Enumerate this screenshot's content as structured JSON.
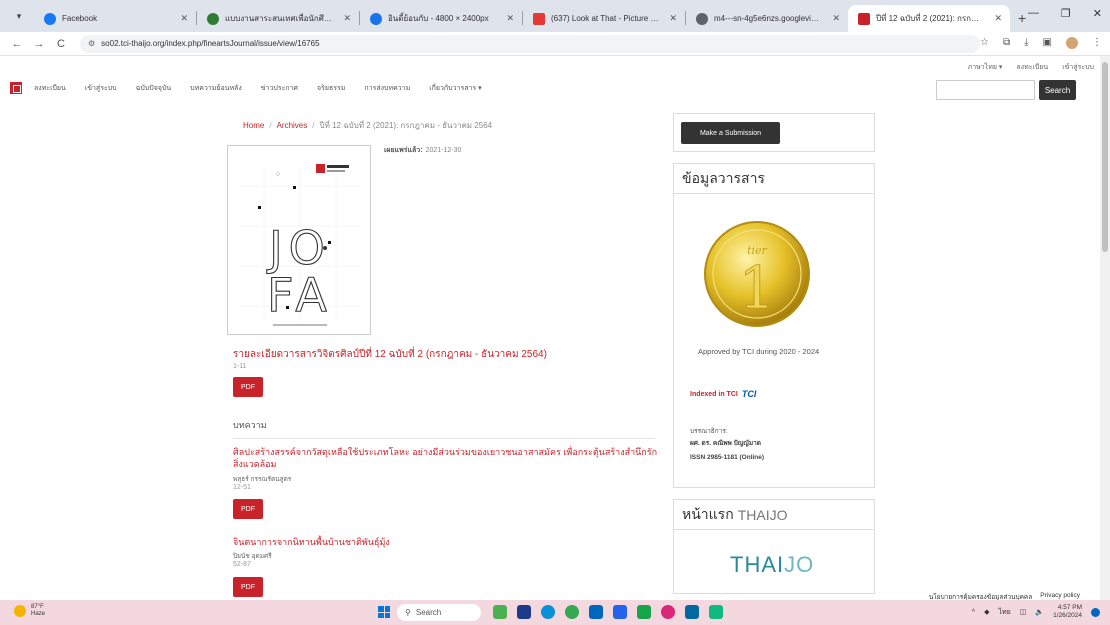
{
  "browser": {
    "tabs": [
      {
        "title": "Facebook",
        "color": "#1877f2",
        "active": false
      },
      {
        "title": "แบบงานสาระสนเทศเพื่อนักศึกษ",
        "color": "#2e7d32",
        "active": false
      },
      {
        "title": "อินดี้ย้อนกับ - 4800 × 2400px",
        "color": "#1a73e8",
        "active": false
      },
      {
        "title": "(637) Look at That - Picture Boo",
        "color": "#e53935",
        "active": false
      },
      {
        "title": "m4---sn-4g5e6nzs.googlevideo",
        "color": "#5f6368",
        "active": false
      },
      {
        "title": "ปีที่ 12 ฉบับที่ 2 (2021): กรกฎาคม",
        "color": "#c8232a",
        "active": true
      }
    ],
    "url": "so02.tci-thaijo.org/index.php/fineartsJournal/issue/view/16765"
  },
  "site": {
    "topright_links": [
      "ภาษาไทย ▾",
      "ลงทะเบียน",
      "เข้าสู่ระบบ"
    ],
    "nav_items": [
      "ลงทะเบียน",
      "เข้าสู่ระบบ",
      "ฉบับปัจจุบัน",
      "บทความย้อนหลัง",
      "ข่าวประกาศ",
      "จริยธรรม",
      "การส่งบทความ",
      "เกี่ยวกับวารสาร ▾"
    ],
    "search_button": "Search"
  },
  "breadcrumb": {
    "home": "Home",
    "archives": "Archives",
    "current": "ปีที่ 12 ฉบับที่ 2 (2021): กรกฎาคม - ธันวาคม 2564"
  },
  "issue": {
    "published_label": "เผยแพร่แล้ว:",
    "published_date": "2021-12-30",
    "cover_text": "JOFA",
    "toc_title": "รายละเอียดวารสารวิจิตรศิลป์ปีที่ 12 ฉบับที่ 2 (กรกฎาคม - ธันวาคม 2564)",
    "toc_pages": "1-11",
    "pdf_label": "PDF",
    "section_heading": "บทความ",
    "articles": [
      {
        "title": "ศิลปะสร้างสรรค์จากวัสดุเหลือใช้ประเภทโลหะ อย่างมีส่วนร่วมของเยาวชนอาสาสมัคร เพื่อกระตุ้นสร้างสำนึกรักสิ่งแวดล้อม",
        "author": "พสุธร์ กรรณรัตนสูตร",
        "pages": "12-51"
      },
      {
        "title": "จินตนาการจากนิทานพื้นบ้านชาติพันธุ์มุ้ง",
        "author": "ปิยนัช อุดมศรี",
        "pages": "52-87"
      }
    ]
  },
  "sidebar": {
    "submit_button": "Make a Submission",
    "info_heading": "ข้อมูลวารสาร",
    "tier_caption": "Approved by TCI during 2020 - 2024",
    "indexed_label": "Indexed in TCI",
    "tci_logo": "TCI",
    "editor_label": "บรรณาธิการ:",
    "editor_name": "ผศ. ดร. คณิพพ ปัญญัมาด",
    "issn": "ISSN 2985-1181 (Online)",
    "thaijo_heading_th": "หน้าแรก",
    "thaijo_heading_en": "THAIJO",
    "thaijo_logo_a": "THAI",
    "thaijo_logo_b": "JO"
  },
  "footer": {
    "privacy_th": "นโยบายการคุ้มครองข้อมูลส่วนบุคคล",
    "privacy_en": "Privacy policy"
  },
  "taskbar": {
    "temp": "87°F",
    "weather": "Haze",
    "search_placeholder": "Search",
    "time": "4:57 PM",
    "date": "1/26/2024"
  }
}
